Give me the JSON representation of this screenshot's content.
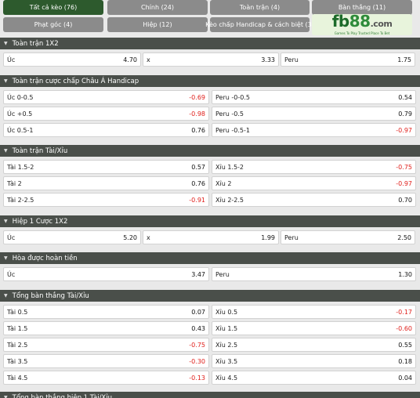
{
  "tabs": [
    {
      "label": "Tất cả kèo (76)",
      "active": true
    },
    {
      "label": "Chính (24)"
    },
    {
      "label": "Toàn trận (4)"
    },
    {
      "label": "Bàn thắng (11)"
    },
    {
      "label": "Phạt góc (4)"
    },
    {
      "label": "Hiệp (12)"
    },
    {
      "label": "Kèo chấp Handicap & cách biệt (3)"
    }
  ],
  "logo": {
    "fb": "fb",
    "n88": "88",
    "com": ".com",
    "tagline": "Games To Play   Trusted Place To Bet"
  },
  "sections": [
    {
      "title": "Toàn trận 1X2",
      "cols": 3,
      "rows": [
        [
          {
            "label": "Úc",
            "value": "4.70"
          },
          {
            "label": "x",
            "value": "3.33"
          },
          {
            "label": "Peru",
            "value": "1.75"
          }
        ]
      ]
    },
    {
      "title": "Toàn trận cược chấp Châu Á Handicap",
      "cols": 2,
      "rows": [
        [
          {
            "label": "Úc 0-0.5",
            "value": "-0.69",
            "neg": true
          },
          {
            "label": "Peru -0-0.5",
            "value": "0.54"
          }
        ],
        [
          {
            "label": "Úc +0.5",
            "value": "-0.98",
            "neg": true
          },
          {
            "label": "Peru -0.5",
            "value": "0.79"
          }
        ],
        [
          {
            "label": "Úc 0.5-1",
            "value": "0.76"
          },
          {
            "label": "Peru -0.5-1",
            "value": "-0.97",
            "neg": true
          }
        ]
      ]
    },
    {
      "title": "Toàn trận Tài/Xỉu",
      "cols": 2,
      "rows": [
        [
          {
            "label": "Tài 1.5-2",
            "value": "0.57"
          },
          {
            "label": "Xỉu 1.5-2",
            "value": "-0.75",
            "neg": true
          }
        ],
        [
          {
            "label": "Tài 2",
            "value": "0.76"
          },
          {
            "label": "Xỉu 2",
            "value": "-0.97",
            "neg": true
          }
        ],
        [
          {
            "label": "Tài 2-2.5",
            "value": "-0.91",
            "neg": true
          },
          {
            "label": "Xỉu 2-2.5",
            "value": "0.70"
          }
        ]
      ]
    },
    {
      "title": "Hiệp 1 Cược 1X2",
      "cols": 3,
      "rows": [
        [
          {
            "label": "Úc",
            "value": "5.20"
          },
          {
            "label": "x",
            "value": "1.99"
          },
          {
            "label": "Peru",
            "value": "2.50"
          }
        ]
      ]
    },
    {
      "title": "Hòa được hoàn tiền",
      "cols": 2,
      "rows": [
        [
          {
            "label": "Úc",
            "value": "3.47"
          },
          {
            "label": "Peru",
            "value": "1.30"
          }
        ]
      ]
    },
    {
      "title": "Tổng bàn thắng Tài/Xỉu",
      "cols": 2,
      "rows": [
        [
          {
            "label": "Tài 0.5",
            "value": "0.07"
          },
          {
            "label": "Xỉu 0.5",
            "value": "-0.17",
            "neg": true
          }
        ],
        [
          {
            "label": "Tài 1.5",
            "value": "0.43"
          },
          {
            "label": "Xỉu 1.5",
            "value": "-0.60",
            "neg": true
          }
        ],
        [
          {
            "label": "Tài 2.5",
            "value": "-0.75",
            "neg": true
          },
          {
            "label": "Xỉu 2.5",
            "value": "0.55"
          }
        ],
        [
          {
            "label": "Tài 3.5",
            "value": "-0.30",
            "neg": true
          },
          {
            "label": "Xỉu 3.5",
            "value": "0.18"
          }
        ],
        [
          {
            "label": "Tài 4.5",
            "value": "-0.13",
            "neg": true
          },
          {
            "label": "Xỉu 4.5",
            "value": "0.04"
          }
        ]
      ]
    },
    {
      "title": "Tổng bàn thắng hiệp 1 Tài/Xỉu",
      "cols": 2,
      "rows": []
    }
  ]
}
